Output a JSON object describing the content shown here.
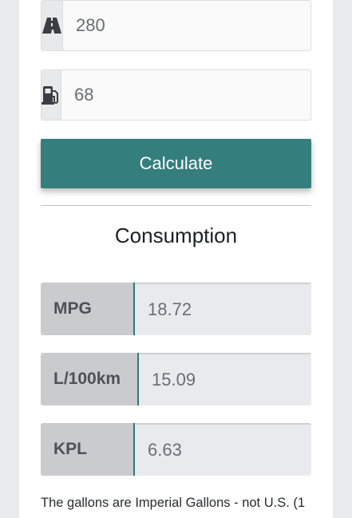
{
  "inputs": {
    "distance": {
      "value": "280",
      "icon": "road-icon"
    },
    "fuel": {
      "value": "68",
      "icon": "gas-pump-icon"
    }
  },
  "calculate_label": "Calculate",
  "consumption": {
    "title": "Consumption",
    "results": [
      {
        "label": "MPG",
        "value": "18.72"
      },
      {
        "label": "L/100km",
        "value": "15.09"
      },
      {
        "label": "KPL",
        "value": "6.63"
      }
    ]
  },
  "note": "The gallons are Imperial Gallons - not U.S. (1",
  "colors": {
    "accent": "#347e7d",
    "label_bg": "#cacbcf"
  }
}
